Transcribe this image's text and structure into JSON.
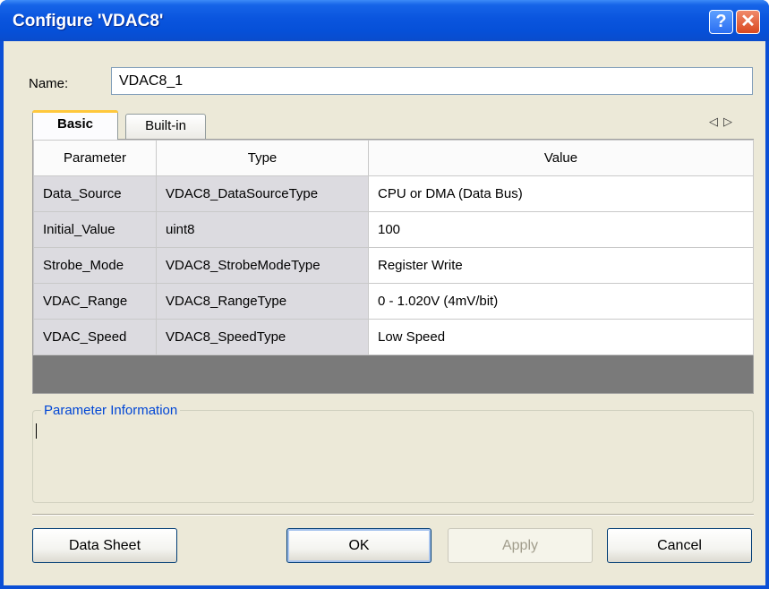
{
  "window": {
    "title": "Configure 'VDAC8'",
    "help_glyph": "?",
    "close_glyph": "✕"
  },
  "name_field": {
    "label": "Name:",
    "value": "VDAC8_1"
  },
  "tabs": [
    {
      "label": "Basic",
      "active": true
    },
    {
      "label": "Built-in",
      "active": false
    }
  ],
  "tab_scroll": {
    "left_icon": "triangle-left-icon",
    "right_icon": "triangle-right-icon"
  },
  "grid": {
    "columns": [
      "Parameter",
      "Type",
      "Value"
    ],
    "rows": [
      {
        "parameter": "Data_Source",
        "type": "VDAC8_DataSourceType",
        "value": "CPU or DMA (Data Bus)"
      },
      {
        "parameter": "Initial_Value",
        "type": "uint8",
        "value": "100"
      },
      {
        "parameter": "Strobe_Mode",
        "type": "VDAC8_StrobeModeType",
        "value": "Register Write"
      },
      {
        "parameter": "VDAC_Range",
        "type": "VDAC8_RangeType",
        "value": "0 - 1.020V (4mV/bit)"
      },
      {
        "parameter": "VDAC_Speed",
        "type": "VDAC8_SpeedType",
        "value": "Low Speed"
      }
    ]
  },
  "info": {
    "legend": "Parameter Information"
  },
  "buttons": {
    "datasheet": "Data Sheet",
    "ok": "OK",
    "apply": "Apply",
    "cancel": "Cancel"
  },
  "colors": {
    "title_bar": "#0a55de",
    "dialog_bg": "#ece9d8",
    "legend_text": "#0046d5",
    "grid_empty": "#7a7a7a"
  }
}
